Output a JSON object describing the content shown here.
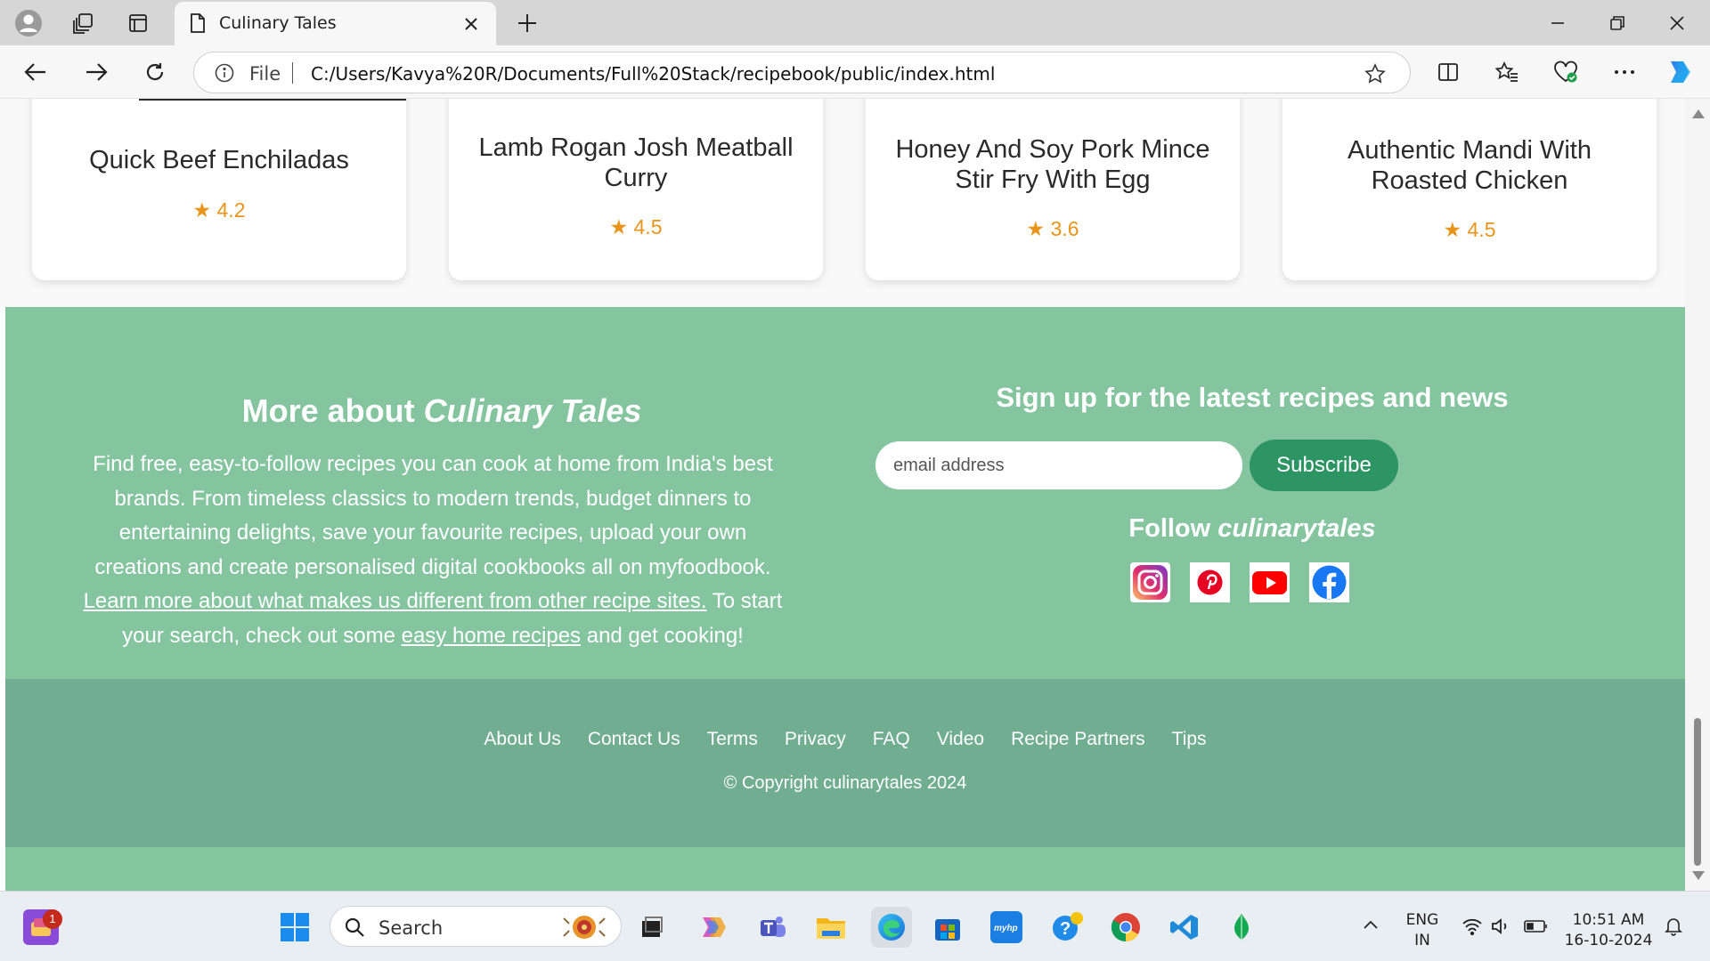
{
  "browser": {
    "tab_title": "Culinary Tales",
    "address_scheme_label": "File",
    "url": "C:/Users/Kavya%20R/Documents/Full%20Stack/recipebook/public/index.html"
  },
  "recipes": [
    {
      "title": "Quick Beef Enchiladas",
      "rating": "★ 4.2"
    },
    {
      "title": "Lamb Rogan Josh Meatball Curry",
      "rating": "★ 4.5"
    },
    {
      "title": "Honey And Soy Pork Mince Stir Fry With Egg",
      "rating": "★ 3.6"
    },
    {
      "title": "Authentic Mandi With Roasted Chicken",
      "rating": "★ 4.5"
    }
  ],
  "about": {
    "title_prefix": "More about ",
    "title_brand": "Culinary Tales",
    "text_1": "Find free, easy-to-follow recipes you can cook at home from India's best brands. From timeless classics to modern trends, budget dinners to entertaining delights, save your favourite recipes, upload your own creations and create personalised digital cookbooks all on myfoodbook. ",
    "link_1": "Learn more about what makes us different from other recipe sites.",
    "text_2": " To start your search, check out some ",
    "link_2": "easy home recipes",
    "text_3": " and get cooking!"
  },
  "signup": {
    "title": "Sign up for the latest recipes and news",
    "email_placeholder": "email address",
    "button_label": "Subscribe"
  },
  "follow": {
    "prefix": "Follow ",
    "handle": "culinarytales",
    "socials": [
      "instagram-icon",
      "pinterest-icon",
      "youtube-icon",
      "facebook-icon"
    ]
  },
  "footer": {
    "links": [
      "About Us",
      "Contact Us",
      "Terms",
      "Privacy",
      "FAQ",
      "Video",
      "Recipe Partners",
      "Tips"
    ],
    "copyright": "© Copyright culinarytales 2024"
  },
  "taskbar": {
    "search_label": "Search",
    "notification_count": "1",
    "lang_primary": "ENG",
    "lang_secondary": "IN",
    "time": "10:51 AM",
    "date": "16-10-2024"
  },
  "colors": {
    "green_section": "#84c59f",
    "footer_bar": "#70ad91",
    "subscribe_button": "#2d9463",
    "rating_star": "#e8941a"
  }
}
